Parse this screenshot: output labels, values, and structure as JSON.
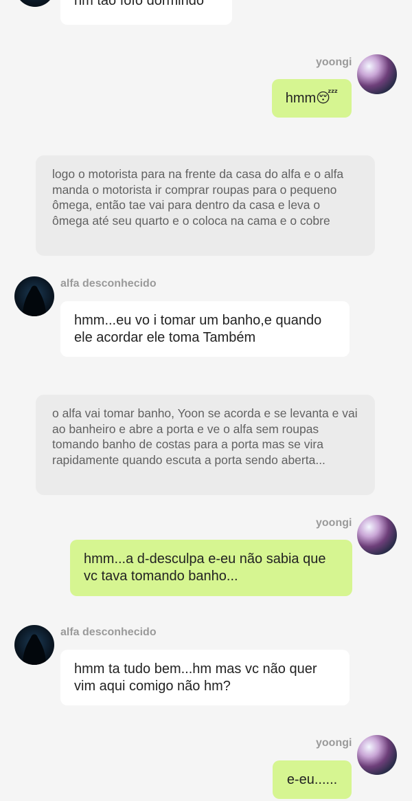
{
  "messages": [
    {
      "text": "hm tão fofo dormindo"
    },
    {
      "sender": "yoongi",
      "text": "hmm😴"
    },
    {
      "narration": "logo o motorista para na frente da casa do alfa e o alfa manda o motorista ir comprar roupas para o pequeno ômega, então tae vai para dentro da casa e leva o ômega até seu quarto e o coloca na cama e o cobre"
    },
    {
      "sender": "alfa desconhecido",
      "text": "hmm...eu vo i tomar um banho,e quando ele acordar ele toma Também"
    },
    {
      "narration": "o alfa vai tomar banho, Yoon se acorda e se levanta e vai ao banheiro e abre a porta e ve o alfa sem roupas tomando banho de costas para a porta mas se vira rapidamente quando escuta a porta sendo aberta..."
    },
    {
      "sender": "yoongi",
      "text": "hmm...a d-desculpa e-eu não sabia que vc tava tomando banho..."
    },
    {
      "sender": "alfa desconhecido",
      "text": "hmm ta tudo bem...hm mas vc não quer vim aqui comigo não hm?"
    },
    {
      "sender": "yoongi",
      "text": "e-eu......"
    }
  ],
  "colors": {
    "background": "#f5f5f5",
    "bubble_left": "#ffffff",
    "bubble_right": "#d6f591",
    "narration": "#ebebeb"
  }
}
